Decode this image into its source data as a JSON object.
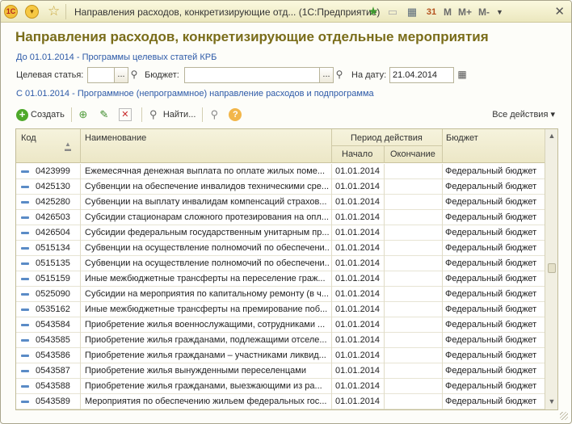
{
  "window": {
    "title": "Направления расходов, конкретизирующие отд...  (1С:Предприятие)",
    "logo_text": "1С",
    "toolbar_m": [
      "M",
      "M+",
      "M-"
    ],
    "icons": [
      "app-logo-icon",
      "menu-circle-icon",
      "favorite-star-icon",
      "add-favorite-icon",
      "document-icon",
      "calculator-icon",
      "calendar-icon",
      "dropdown-icon",
      "close-icon"
    ],
    "calendar_glyph": "31"
  },
  "form": {
    "title": "Направления расходов, конкретизирующие отдельные мероприятия",
    "link_programs": "До 01.01.2014 - Программы целевых статей КРБ",
    "link_program_directions": "С 01.01.2014 - Программное (непрограммное) направление расходов и подпрограмма"
  },
  "filters": {
    "target_label": "Целевая статья:",
    "target_value": "",
    "budget_label": "Бюджет:",
    "budget_value": "",
    "date_label": "На дату:",
    "date_value": "21.04.2014",
    "select_glyph": "...",
    "search_glyph": "🔍"
  },
  "toolbar": {
    "create_label": "Создать",
    "find_label": "Найти...",
    "all_actions_label": "Все действия ▾",
    "help_glyph": "?"
  },
  "table": {
    "columns": {
      "code": "Код",
      "name": "Наименование",
      "period": "Период действия",
      "start": "Начало",
      "end": "Окончание",
      "budget": "Бюджет"
    },
    "rows": [
      {
        "code": "0423999",
        "name": "Ежемесячная денежная выплата по оплате жилых поме...",
        "start": "01.01.2014",
        "end": "",
        "budget": "Федеральный бюджет"
      },
      {
        "code": "0425130",
        "name": "Субвенции на обеспечение инвалидов техническими сре...",
        "start": "01.01.2014",
        "end": "",
        "budget": "Федеральный бюджет"
      },
      {
        "code": "0425280",
        "name": "Субвенции на выплату инвалидам компенсаций страхов...",
        "start": "01.01.2014",
        "end": "",
        "budget": "Федеральный бюджет"
      },
      {
        "code": "0426503",
        "name": "Субсидии стационарам сложного протезирования на опл...",
        "start": "01.01.2014",
        "end": "",
        "budget": "Федеральный бюджет"
      },
      {
        "code": "0426504",
        "name": "Субсидии федеральным государственным унитарным пр...",
        "start": "01.01.2014",
        "end": "",
        "budget": "Федеральный бюджет"
      },
      {
        "code": "0515134",
        "name": "Субвенции на осуществление полномочий по обеспечени...",
        "start": "01.01.2014",
        "end": "",
        "budget": "Федеральный бюджет"
      },
      {
        "code": "0515135",
        "name": "Субвенции на осуществление полномочий по обеспечени...",
        "start": "01.01.2014",
        "end": "",
        "budget": "Федеральный бюджет"
      },
      {
        "code": "0515159",
        "name": "Иные межбюджетные трансферты на переселение граж...",
        "start": "01.01.2014",
        "end": "",
        "budget": "Федеральный бюджет"
      },
      {
        "code": "0525090",
        "name": "Субсидии на мероприятия по капитальному ремонту (в ч...",
        "start": "01.01.2014",
        "end": "",
        "budget": "Федеральный бюджет"
      },
      {
        "code": "0535162",
        "name": "Иные межбюджетные трансферты на премирование поб...",
        "start": "01.01.2014",
        "end": "",
        "budget": "Федеральный бюджет"
      },
      {
        "code": "0543584",
        "name": "Приобретение жилья военнослужащими, сотрудниками ...",
        "start": "01.01.2014",
        "end": "",
        "budget": "Федеральный бюджет"
      },
      {
        "code": "0543585",
        "name": "Приобретение жилья гражданами, подлежащими отселе...",
        "start": "01.01.2014",
        "end": "",
        "budget": "Федеральный бюджет"
      },
      {
        "code": "0543586",
        "name": "Приобретение жилья гражданами – участниками ликвид...",
        "start": "01.01.2014",
        "end": "",
        "budget": "Федеральный бюджет"
      },
      {
        "code": "0543587",
        "name": "Приобретение жилья вынужденными переселенцами",
        "start": "01.01.2014",
        "end": "",
        "budget": "Федеральный бюджет"
      },
      {
        "code": "0543588",
        "name": "Приобретение жилья гражданами, выезжающими из ра...",
        "start": "01.01.2014",
        "end": "",
        "budget": "Федеральный бюджет"
      },
      {
        "code": "0543589",
        "name": "Мероприятия по обеспечению жильем федеральных гос...",
        "start": "01.01.2014",
        "end": "",
        "budget": "Федеральный бюджет"
      }
    ]
  }
}
